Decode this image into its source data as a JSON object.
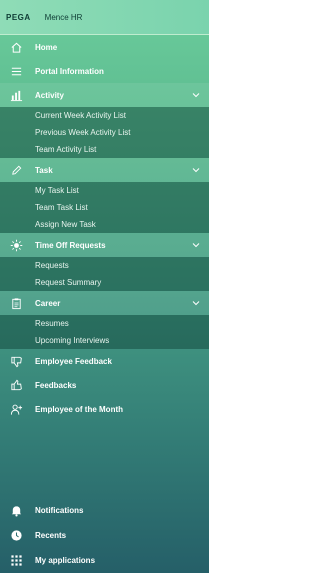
{
  "header": {
    "brand": "PEGA",
    "app_name": "Mence HR"
  },
  "menu": {
    "home": "Home",
    "portal_information": "Portal Information",
    "activity": {
      "label": "Activity",
      "items": [
        "Current Week Activity List",
        "Previous Week Activity List",
        "Team Activity List"
      ]
    },
    "task": {
      "label": "Task",
      "items": [
        "My Task List",
        "Team Task List",
        "Assign New Task"
      ]
    },
    "time_off": {
      "label": "Time Off Requests",
      "items": [
        "Requests",
        "Request Summary"
      ]
    },
    "career": {
      "label": "Career",
      "items": [
        "Resumes",
        "Upcoming Interviews"
      ]
    },
    "employee_feedback": "Employee Feedback",
    "feedbacks": "Feedbacks",
    "employee_of_month": "Employee of the Month"
  },
  "footer": {
    "notifications": "Notifications",
    "recents": "Recents",
    "my_applications": "My applications"
  },
  "icons": {
    "home": "home-icon",
    "portal": "list-icon",
    "activity": "bar-chart-icon",
    "task": "pencil-icon",
    "time_off": "sun-icon",
    "career": "clipboard-icon",
    "employee_feedback": "thumbs-down-icon",
    "feedbacks": "thumbs-up-icon",
    "employee_of_month": "add-user-icon",
    "notifications": "bell-icon",
    "recents": "clock-icon",
    "my_applications": "grid-icon",
    "chevron": "chevron-down-icon"
  }
}
